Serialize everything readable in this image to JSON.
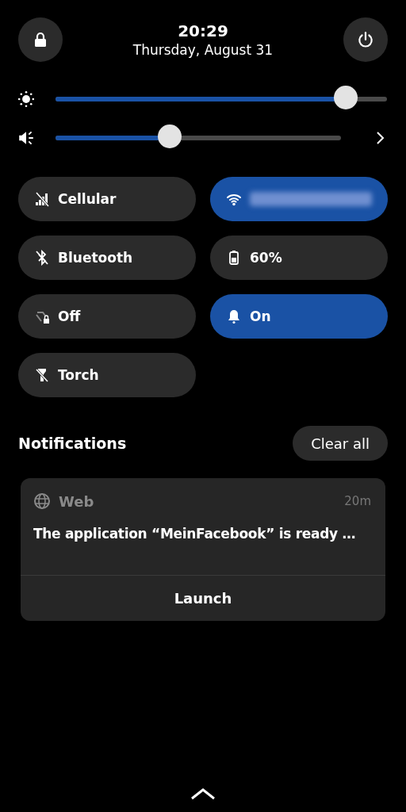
{
  "header": {
    "time": "20:29",
    "date": "Thursday, August 31"
  },
  "sliders": [
    {
      "kind": "brightness",
      "level": 0.875,
      "more": false
    },
    {
      "kind": "volume",
      "level": 0.4,
      "more": true
    }
  ],
  "toggles": [
    {
      "kind": "cellular",
      "label": "Cellular",
      "on": false
    },
    {
      "kind": "wifi",
      "on": true
    },
    {
      "kind": "bluetooth",
      "label": "Bluetooth",
      "on": false
    },
    {
      "kind": "battery",
      "label": "60%",
      "on": false
    },
    {
      "kind": "rotation",
      "label": "Off",
      "on": false
    },
    {
      "kind": "bell",
      "label": "On",
      "on": true
    },
    {
      "kind": "torch",
      "label": "Torch",
      "on": false
    }
  ],
  "notifications": {
    "title": "Notifications",
    "clear_button": "Clear all",
    "items": [
      {
        "app": "Web",
        "time": "20m",
        "body": "The application “MeinFacebook” is ready …",
        "action": "Launch"
      }
    ]
  }
}
